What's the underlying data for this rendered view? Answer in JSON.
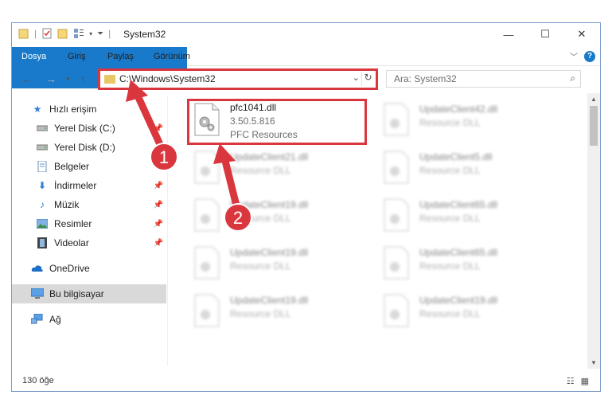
{
  "window": {
    "title": "System32",
    "controls": {
      "minimize": "—",
      "maximize": "☐",
      "close": "✕"
    }
  },
  "ribbon": {
    "tabs": [
      {
        "label": "Dosya",
        "active": true
      },
      {
        "label": "Giriş"
      },
      {
        "label": "Paylaş"
      },
      {
        "label": "Görünüm"
      }
    ],
    "help": "?"
  },
  "address": {
    "path": "C:\\Windows\\System32",
    "search_placeholder": "Ara: System32"
  },
  "sidebar": {
    "items": [
      {
        "label": "Hızlı erişim",
        "icon": "star-icon"
      },
      {
        "label": "Yerel Disk (C:)",
        "icon": "drive-icon",
        "pinned": true
      },
      {
        "label": "Yerel Disk (D:)",
        "icon": "drive-icon",
        "pinned": true
      },
      {
        "label": "Belgeler",
        "icon": "documents-icon",
        "pinned": true
      },
      {
        "label": "İndirmeler",
        "icon": "download-icon",
        "pinned": true
      },
      {
        "label": "Müzik",
        "icon": "music-icon",
        "pinned": true
      },
      {
        "label": "Resimler",
        "icon": "pictures-icon",
        "pinned": true
      },
      {
        "label": "Videolar",
        "icon": "videos-icon",
        "pinned": true
      },
      {
        "label": "OneDrive",
        "icon": "cloud-icon"
      },
      {
        "label": "Bu bilgisayar",
        "icon": "computer-icon",
        "selected": true
      },
      {
        "label": "Ağ",
        "icon": "network-icon"
      }
    ]
  },
  "files": {
    "highlighted": {
      "name": "pfc1041.dll",
      "version": "3.50.5.816",
      "description": "PFC Resources"
    },
    "others": [
      {
        "name": "UpdateClient42.dll",
        "description": "Resource DLL"
      },
      {
        "name": "UpdateClient21.dll",
        "description": "Resource DLL"
      },
      {
        "name": "UpdateClient5.dll",
        "description": "Resource DLL"
      },
      {
        "name": "UpdateClient19.dll",
        "description": "Resource DLL"
      },
      {
        "name": "UpdateClient65.dll",
        "description": "Resource DLL"
      },
      {
        "name": "UpdateClient19.dll",
        "description": "Resource DLL"
      },
      {
        "name": "UpdateClient65.dll",
        "description": "Resource DLL"
      },
      {
        "name": "UpdateClient19.dll",
        "description": "Resource DLL"
      },
      {
        "name": "UpdateClient19.dll",
        "description": "Resource DLL"
      }
    ]
  },
  "status": {
    "count": "130 öğe"
  },
  "annotations": {
    "step1": "1",
    "step2": "2",
    "color": "#d9363e"
  }
}
